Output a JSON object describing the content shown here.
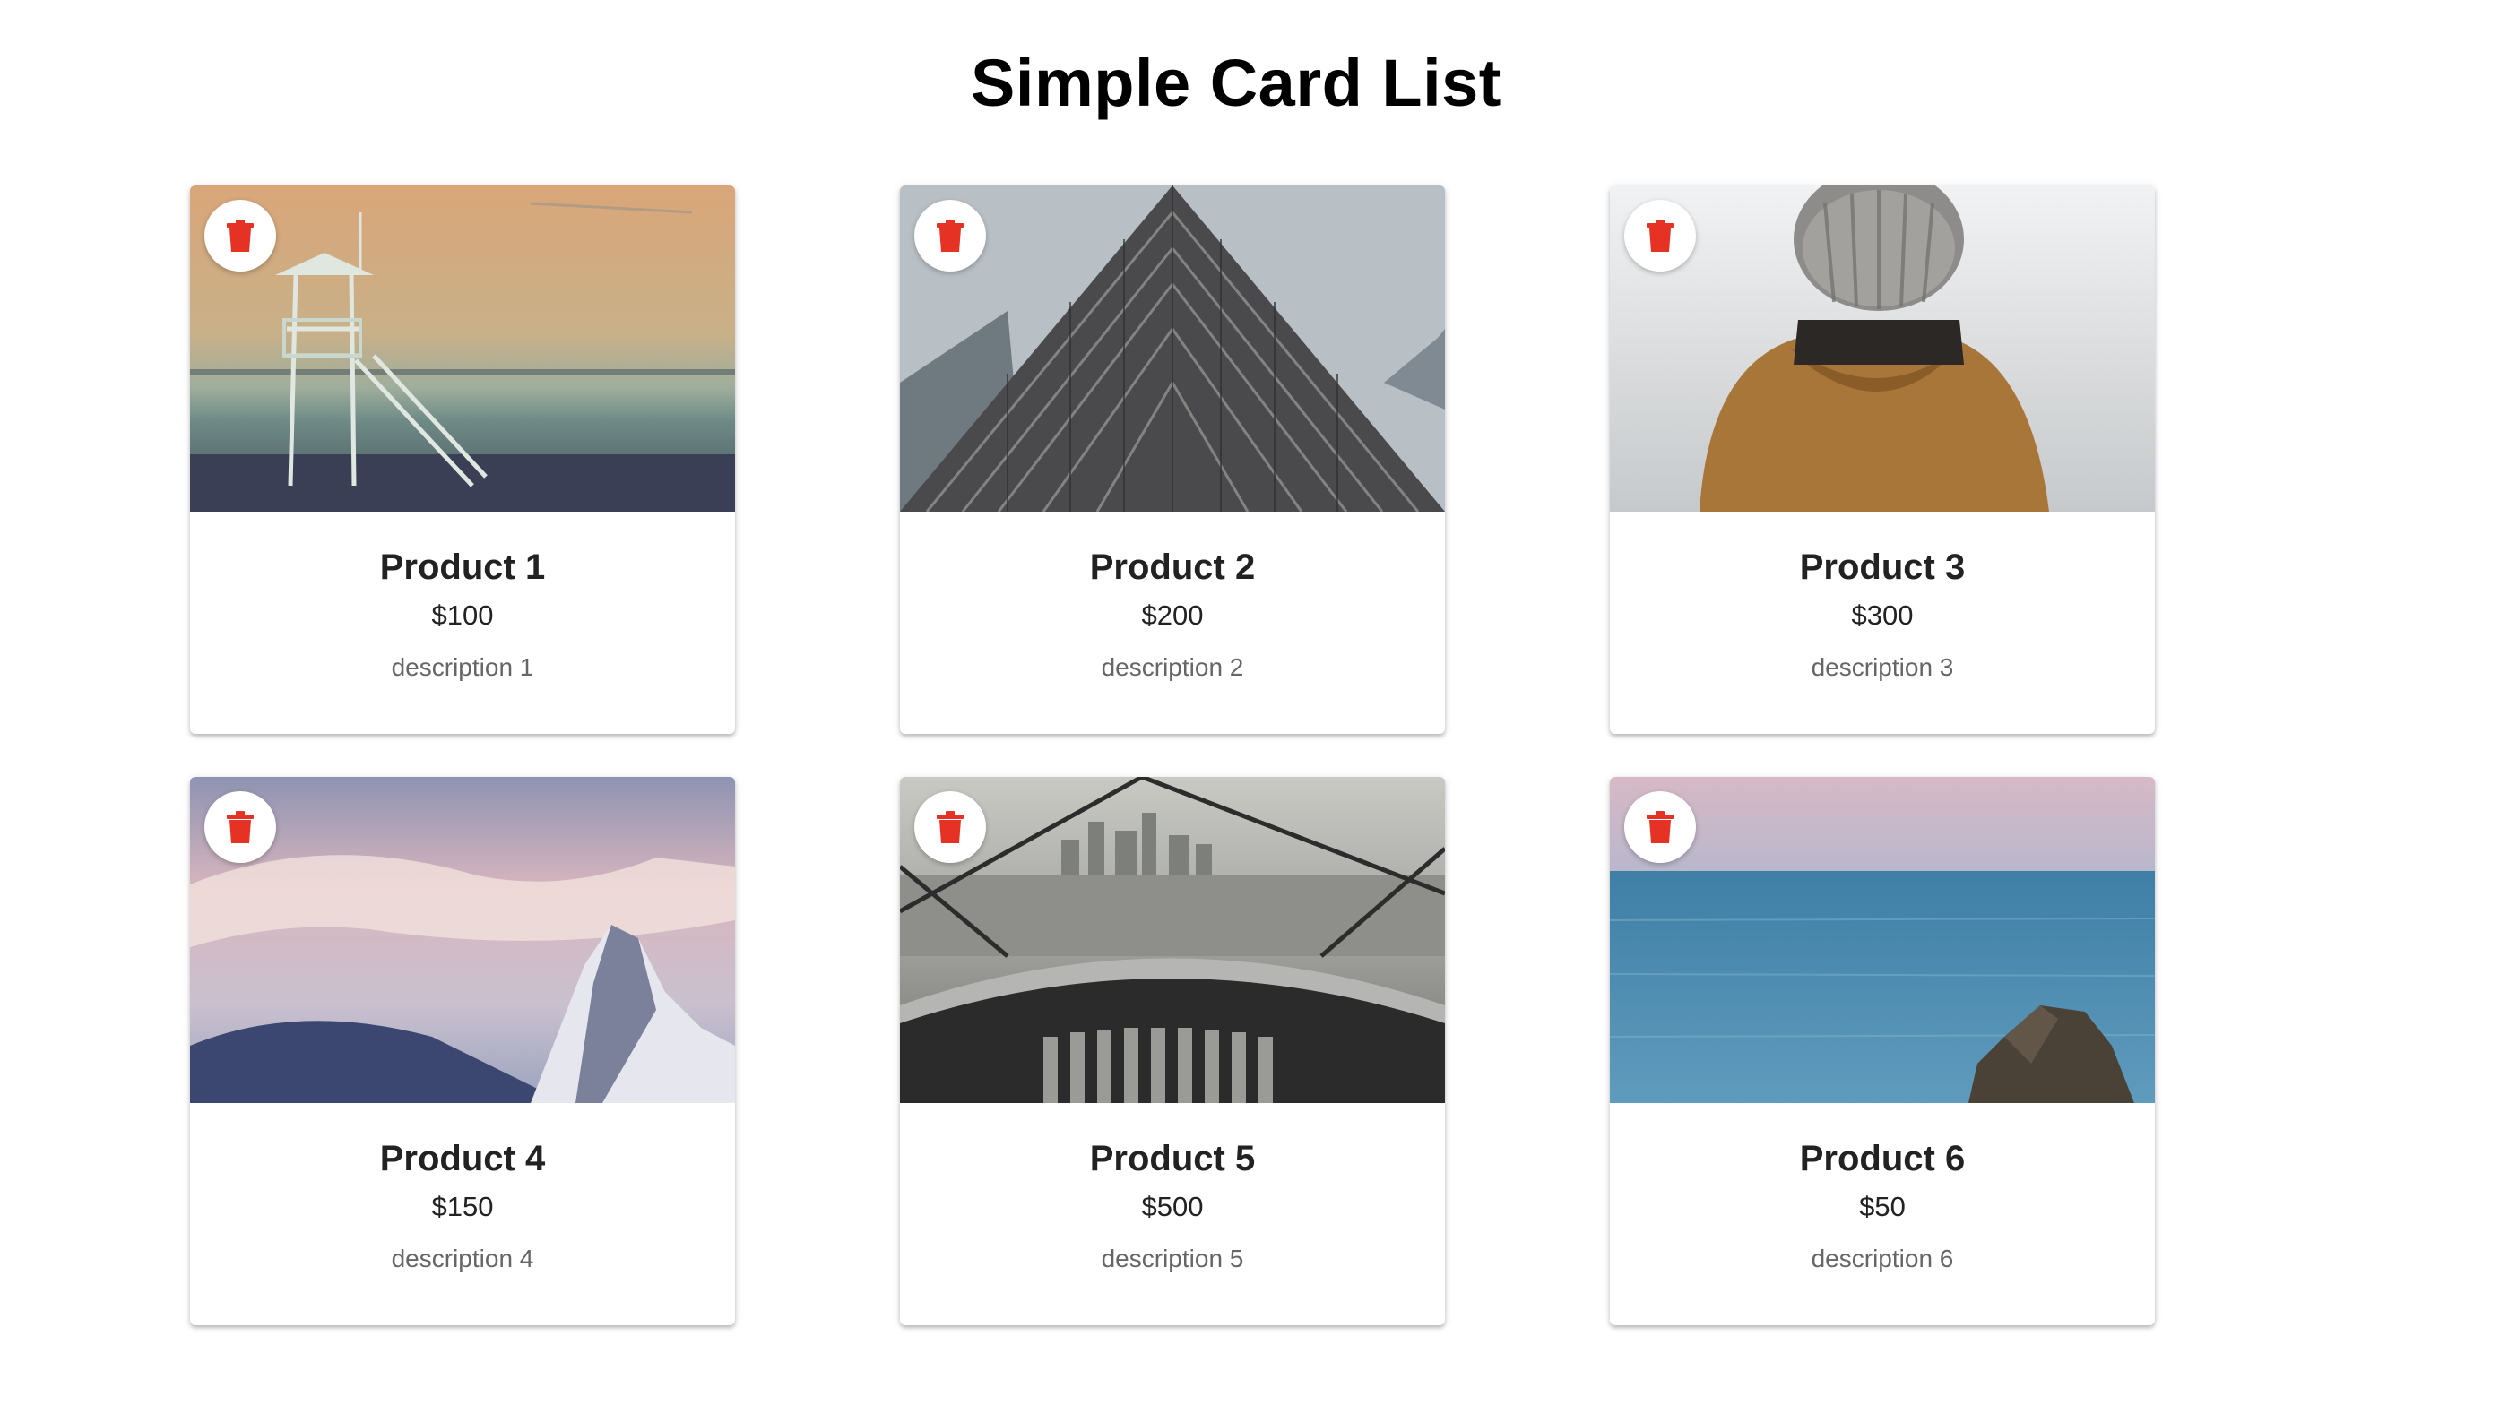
{
  "page": {
    "title": "Simple Card List"
  },
  "colors": {
    "delete_icon": "#e53224",
    "card_shadow": "#00000038",
    "description_text": "#666666"
  },
  "cards": [
    {
      "title": "Product 1",
      "price": "$100",
      "description": "description 1",
      "image": "lifeguard-tower-beach-sunset",
      "icon": "trash-icon"
    },
    {
      "title": "Product 2",
      "price": "$200",
      "description": "description 2",
      "image": "building-looking-up",
      "icon": "trash-icon"
    },
    {
      "title": "Product 3",
      "price": "$300",
      "description": "description 3",
      "image": "person-in-beanie-and-hooded-jacket",
      "icon": "trash-icon"
    },
    {
      "title": "Product 4",
      "price": "$150",
      "description": "description 4",
      "image": "snowy-mountain-peak-pink-sky",
      "icon": "trash-icon"
    },
    {
      "title": "Product 5",
      "price": "$500",
      "description": "description 5",
      "image": "city-view-through-binoculars",
      "icon": "trash-icon"
    },
    {
      "title": "Product 6",
      "price": "$50",
      "description": "description 6",
      "image": "sea-with-rock",
      "icon": "trash-icon"
    }
  ]
}
